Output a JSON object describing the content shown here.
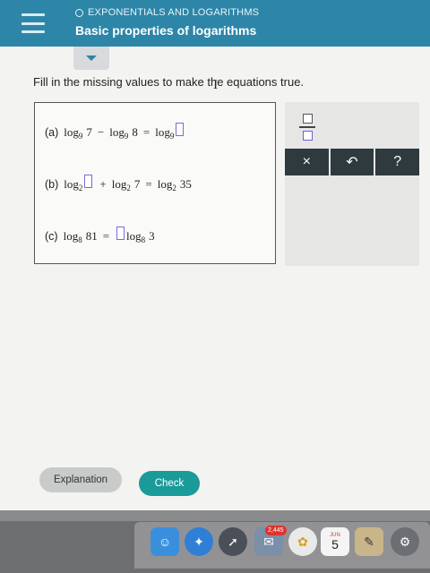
{
  "header": {
    "section": "EXPONENTIALS AND LOGARITHMS",
    "title": "Basic properties of logarithms"
  },
  "instruction": "Fill in the missing values to make the equations true.",
  "equations": {
    "a": {
      "label": "(a)",
      "log1": "log",
      "base1": "9",
      "arg1": "7",
      "op": "−",
      "log2": "log",
      "base2": "9",
      "arg2": "8",
      "eq": "=",
      "log3": "log",
      "base3": "9"
    },
    "b": {
      "label": "(b)",
      "log1": "log",
      "base1": "2",
      "op": "+",
      "log2": "log",
      "base2": "2",
      "arg2": "7",
      "eq": "=",
      "log3": "log",
      "base3": "2",
      "arg3": "35"
    },
    "c": {
      "label": "(c)",
      "log1": "log",
      "base1": "8",
      "arg1": "81",
      "eq": "=",
      "log2": "log",
      "base2": "8",
      "arg2": "3"
    }
  },
  "palette": {
    "clear_label": "×",
    "undo_label": "↶",
    "help_label": "?"
  },
  "buttons": {
    "explanation": "Explanation",
    "check": "Check"
  },
  "dock": {
    "badge": "2,445",
    "calendar_month": "JUN",
    "calendar_day": "5"
  },
  "colors": {
    "header": "#2d86a8",
    "check_button": "#1b9a9a",
    "answer_box_border": "#7a6ad8",
    "palette_button": "#2f3a3f"
  }
}
